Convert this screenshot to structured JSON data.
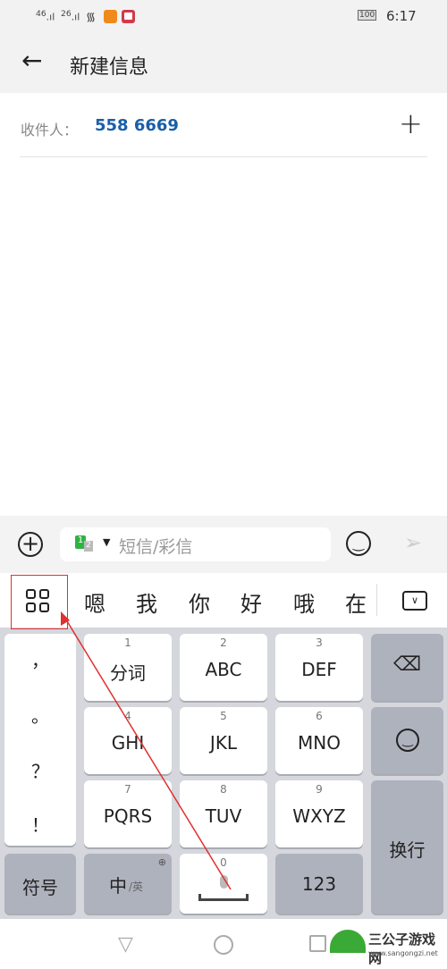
{
  "status": {
    "signal1": "46",
    "signal2": "26",
    "battery": "100",
    "time": "6:17"
  },
  "header": {
    "title": "新建信息"
  },
  "recipient": {
    "label": "收件人：",
    "value": "558 6669"
  },
  "compose": {
    "placeholder": "短信/彩信",
    "sim": "1",
    "sim2": "2"
  },
  "candidates": [
    "嗯",
    "我",
    "你",
    "好",
    "哦",
    "在"
  ],
  "keyboard": {
    "punct": [
      "，",
      "。",
      "？",
      "！"
    ],
    "keys": [
      {
        "n": "1",
        "l": "分词"
      },
      {
        "n": "2",
        "l": "ABC"
      },
      {
        "n": "3",
        "l": "DEF"
      },
      {
        "n": "4",
        "l": "GHI"
      },
      {
        "n": "5",
        "l": "JKL"
      },
      {
        "n": "6",
        "l": "MNO"
      },
      {
        "n": "7",
        "l": "PQRS"
      },
      {
        "n": "8",
        "l": "TUV"
      },
      {
        "n": "9",
        "l": "WXYZ"
      }
    ],
    "symbols": "符号",
    "lang_main": "中",
    "lang_alt": "/英",
    "space_num": "0",
    "num": "123",
    "enter": "换行"
  },
  "watermark": {
    "text": "三公子游戏网",
    "url": "www.sangongzi.net"
  },
  "colors": {
    "accent": "#1a5fa8",
    "annotation": "#e03030"
  }
}
